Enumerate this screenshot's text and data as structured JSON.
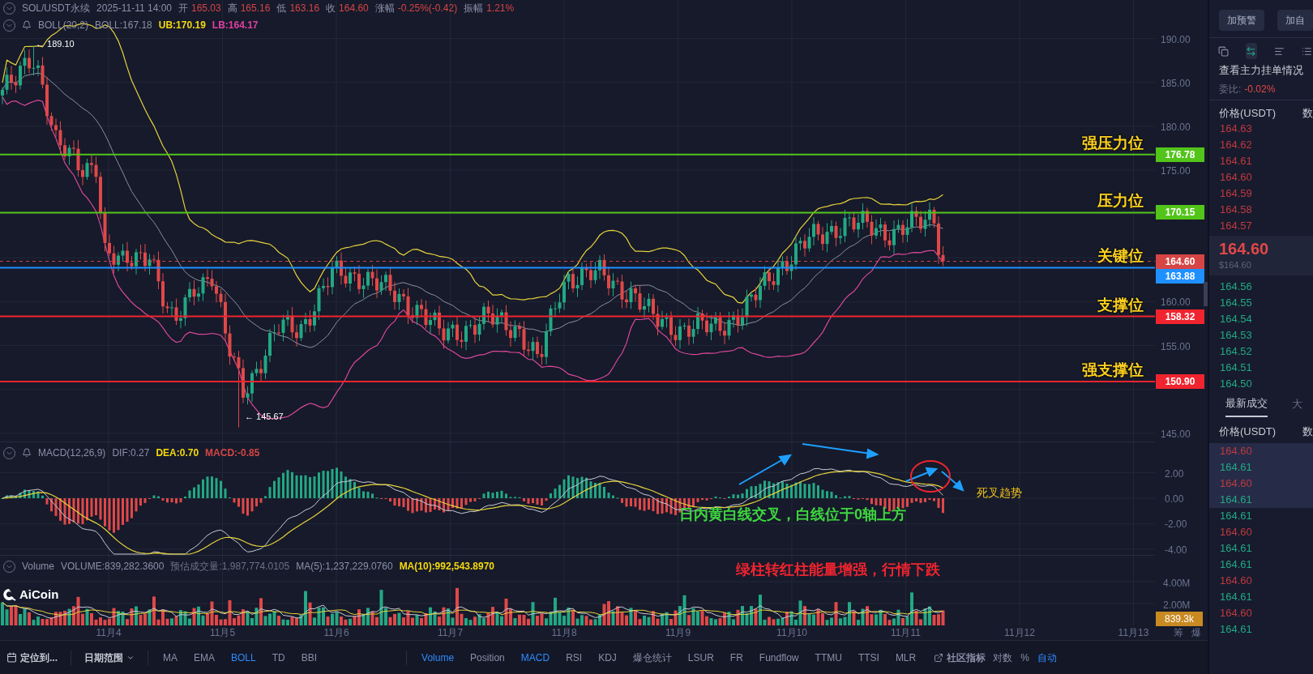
{
  "header": {
    "title": "SOL/USDT永续",
    "time": "2025-11-11 14:00",
    "stats": [
      {
        "label": "开",
        "value": "165.03"
      },
      {
        "label": "高",
        "value": "165.16"
      },
      {
        "label": "低",
        "value": "163.16"
      },
      {
        "label": "收",
        "value": "164.60"
      },
      {
        "label": "涨幅",
        "value": "-0.25%(-0.42)"
      },
      {
        "label": "振幅",
        "value": "1.21%"
      }
    ]
  },
  "boll": {
    "name": "BOLL(20,2)",
    "values": [
      {
        "text": "BOLL:167.18",
        "color": "#8a90a8"
      },
      {
        "text": "UB:170.19",
        "color": "#f5d90a"
      },
      {
        "text": "LB:164.17",
        "color": "#e040a0"
      }
    ]
  },
  "main_chart": {
    "y_ticks": [
      "190.00",
      "185.00",
      "180.00",
      "175.00",
      "160.00",
      "155.00",
      "145.00"
    ],
    "levels": [
      {
        "label": "强压力位",
        "price": "176.78",
        "kind": "resistance"
      },
      {
        "label": "压力位",
        "price": "170.15",
        "kind": "resistance"
      },
      {
        "label": "关键位",
        "price": "163.88",
        "kind": "key"
      },
      {
        "label": "支撑位",
        "price": "158.32",
        "kind": "support"
      },
      {
        "label": "强支撑位",
        "price": "150.90",
        "kind": "support"
      }
    ],
    "current_price": "164.60",
    "high_marker": "← 189.10",
    "low_marker": "← 145.67"
  },
  "macd": {
    "name": "MACD(12,26,9)",
    "values": [
      {
        "text": "DIF:0.27",
        "color": "#8a90a8"
      },
      {
        "text": "DEA:0.70",
        "color": "#f5d90a"
      },
      {
        "text": "MACD:-0.85",
        "color": "#d64545"
      }
    ],
    "y_ticks": [
      "2.00",
      "0.00",
      "-2.00",
      "-4.00"
    ],
    "annotations": [
      {
        "text": "死叉趋势",
        "color": "#f5c518"
      },
      {
        "text": "日内黄白线交叉，白线位于0轴上方",
        "color": "#3fd63f"
      }
    ]
  },
  "volume": {
    "name": "Volume",
    "values": [
      {
        "text": "VOLUME:839,282.3600",
        "color": "#8a90a8"
      },
      {
        "text": "预估成交量:1,987,774.0105",
        "color": "#6b7186"
      },
      {
        "text": "MA(5):1,237,229.0760",
        "color": "#8a90a8"
      },
      {
        "text": "MA(10):992,543.8970",
        "color": "#f5d90a"
      }
    ],
    "y_ticks": [
      "4.00M",
      "2.00M"
    ],
    "current": "839.3k",
    "annotation": {
      "text": "绿柱转红柱能量增强，行情下跌",
      "color": "#f0242f"
    }
  },
  "logo": "AiCoin",
  "x_axis": {
    "labels": [
      "11月4",
      "11月5",
      "11月6",
      "11月7",
      "11月8",
      "11月9",
      "11月10",
      "11月11",
      "11月12",
      "11月13"
    ],
    "side_labels": [
      "筹",
      "爆"
    ]
  },
  "toolbar": {
    "locate": "定位到...",
    "date_range": "日期范围",
    "main_indicators": [
      {
        "label": "MA",
        "selected": false
      },
      {
        "label": "EMA",
        "selected": false
      },
      {
        "label": "BOLL",
        "selected": true
      },
      {
        "label": "TD",
        "selected": false
      },
      {
        "label": "BBI",
        "selected": false
      }
    ],
    "sub_indicators": [
      {
        "label": "Volume",
        "selected": true
      },
      {
        "label": "Position",
        "selected": false
      },
      {
        "label": "MACD",
        "selected": true
      },
      {
        "label": "RSI",
        "selected": false
      },
      {
        "label": "KDJ",
        "selected": false
      },
      {
        "label": "爆仓统计",
        "selected": false
      },
      {
        "label": "LSUR",
        "selected": false
      },
      {
        "label": "FR",
        "selected": false
      },
      {
        "label": "Fundflow",
        "selected": false
      },
      {
        "label": "TTMU",
        "selected": false
      },
      {
        "label": "TTSI",
        "selected": false
      },
      {
        "label": "MLR",
        "selected": false
      }
    ],
    "community": "社区指标",
    "options": [
      {
        "label": "对数",
        "selected": false
      },
      {
        "label": "%",
        "selected": false
      },
      {
        "label": "自动",
        "selected": true
      }
    ]
  },
  "right_panel": {
    "buttons": [
      "加预警",
      "加自"
    ],
    "views": [
      {
        "kind": "copy",
        "selected": false
      },
      {
        "kind": "both",
        "selected": true
      },
      {
        "kind": "bids",
        "selected": false
      },
      {
        "kind": "asks",
        "selected": false
      }
    ],
    "depth_title": "查看主力挂单情况",
    "ratio_label": "委比:",
    "ratio": "-0.02%",
    "columns": [
      "价格(USDT)",
      "数"
    ],
    "asks": [
      "164.63",
      "164.62",
      "164.61",
      "164.60",
      "164.59",
      "164.58",
      "164.57"
    ],
    "last_price": "164.60",
    "last_price_usd": "$164.60",
    "bids": [
      "164.56",
      "164.55",
      "164.54",
      "164.53",
      "164.52",
      "164.51",
      "164.50"
    ],
    "trade_tabs": [
      {
        "label": "最新成交",
        "selected": true
      },
      {
        "label": "大",
        "selected": false
      }
    ],
    "trade_columns": [
      "价格(USDT)",
      "数"
    ],
    "trades": [
      {
        "price": "164.60",
        "color": "#c0393f",
        "highlighted": true
      },
      {
        "price": "164.61",
        "color": "#22a884",
        "highlighted": true
      },
      {
        "price": "164.60",
        "color": "#c0393f",
        "highlighted": true
      },
      {
        "price": "164.61",
        "color": "#22a884",
        "highlighted": true
      },
      {
        "price": "164.61",
        "color": "#22a884",
        "highlighted": false
      },
      {
        "price": "164.60",
        "color": "#c0393f",
        "highlighted": false
      },
      {
        "price": "164.61",
        "color": "#22a884",
        "highlighted": false
      },
      {
        "price": "164.61",
        "color": "#22a884",
        "highlighted": false
      },
      {
        "price": "164.60",
        "color": "#c0393f",
        "highlighted": false
      },
      {
        "price": "164.61",
        "color": "#22a884",
        "highlighted": false
      },
      {
        "price": "164.60",
        "color": "#c0393f",
        "highlighted": false
      },
      {
        "price": "164.61",
        "color": "#22a884",
        "highlighted": false
      }
    ]
  }
}
